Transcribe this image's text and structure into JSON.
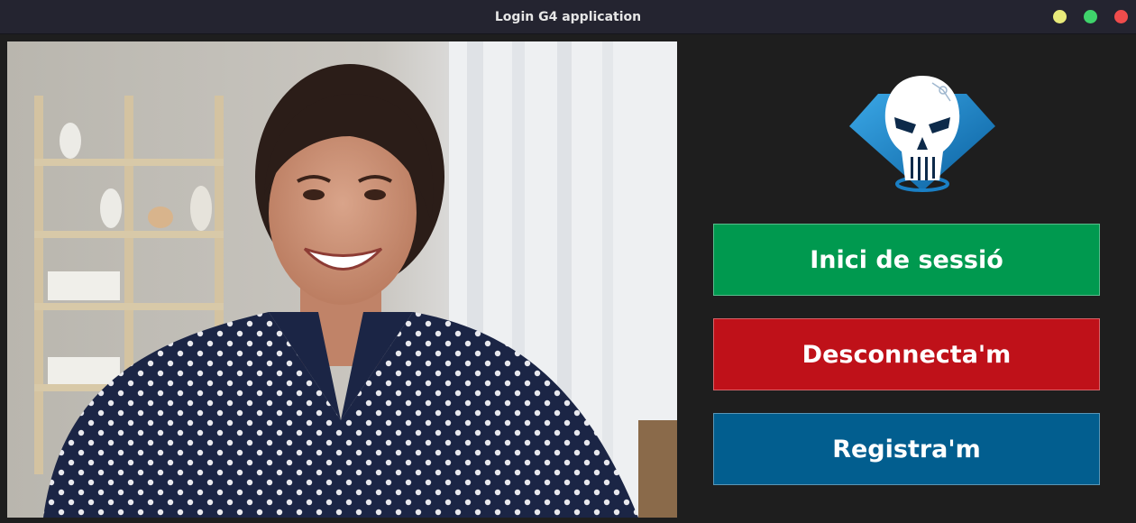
{
  "window": {
    "title": "Login G4 application",
    "controls": [
      "minimize",
      "maximize",
      "close"
    ]
  },
  "photo": {
    "description_icon": "photo-woman-smiling"
  },
  "logo": {
    "icon": "skull-diamond-logo",
    "colors": {
      "diamond": "#1a7fc4",
      "skull": "#ffffff"
    }
  },
  "buttons": {
    "login_label": "Inici de sessió",
    "logout_label": "Desconnecta'm",
    "register_label": "Registra'm"
  },
  "colors": {
    "login": "#00994f",
    "logout": "#bf1119",
    "register": "#025e8f",
    "background": "#1e1e1e"
  }
}
